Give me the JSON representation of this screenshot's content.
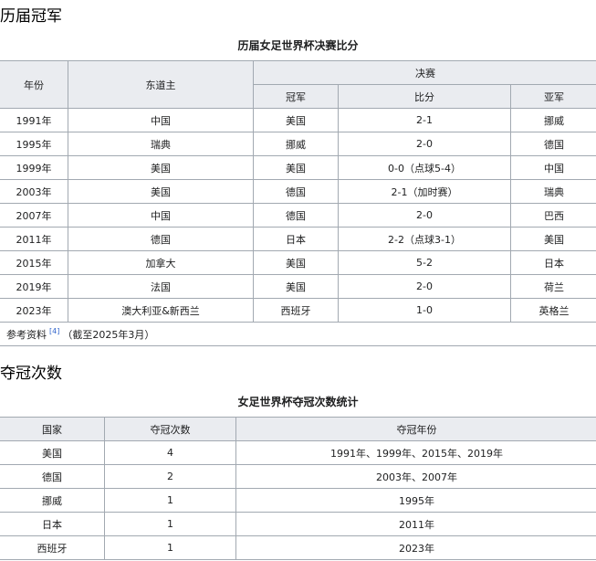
{
  "section1": {
    "heading": "历届冠军",
    "caption": "历届女足世界杯决赛比分",
    "headers": {
      "year": "年份",
      "host": "东道主",
      "final": "决赛",
      "champion": "冠军",
      "score": "比分",
      "runner_up": "亚军"
    },
    "rows": [
      {
        "year": "1991年",
        "host": "中国",
        "champion": "美国",
        "score": "2-1",
        "runner_up": "挪威"
      },
      {
        "year": "1995年",
        "host": "瑞典",
        "champion": "挪威",
        "score": "2-0",
        "runner_up": "德国"
      },
      {
        "year": "1999年",
        "host": "美国",
        "champion": "美国",
        "score": "0-0（点球5-4）",
        "runner_up": "中国"
      },
      {
        "year": "2003年",
        "host": "美国",
        "champion": "德国",
        "score": "2-1（加时赛）",
        "runner_up": "瑞典"
      },
      {
        "year": "2007年",
        "host": "中国",
        "champion": "德国",
        "score": "2-0",
        "runner_up": "巴西"
      },
      {
        "year": "2011年",
        "host": "德国",
        "champion": "日本",
        "score": "2-2（点球3-1）",
        "runner_up": "美国"
      },
      {
        "year": "2015年",
        "host": "加拿大",
        "champion": "美国",
        "score": "5-2",
        "runner_up": "日本"
      },
      {
        "year": "2019年",
        "host": "法国",
        "champion": "美国",
        "score": "2-0",
        "runner_up": "荷兰"
      },
      {
        "year": "2023年",
        "host": "澳大利亚&新西兰",
        "champion": "西班牙",
        "score": "1-0",
        "runner_up": "英格兰"
      }
    ],
    "footnote": {
      "prefix": "参考资料",
      "ref": "[4]",
      "suffix": "（截至2025年3月）"
    }
  },
  "section2": {
    "heading": "夺冠次数",
    "caption": "女足世界杯夺冠次数统计",
    "headers": {
      "country": "国家",
      "titles": "夺冠次数",
      "years": "夺冠年份"
    },
    "rows": [
      {
        "country": "美国",
        "titles": "4",
        "years": "1991年、1999年、2015年、2019年"
      },
      {
        "country": "德国",
        "titles": "2",
        "years": "2003年、2007年"
      },
      {
        "country": "挪威",
        "titles": "1",
        "years": "1995年"
      },
      {
        "country": "日本",
        "titles": "1",
        "years": "2011年"
      },
      {
        "country": "西班牙",
        "titles": "1",
        "years": "2023年"
      }
    ]
  }
}
